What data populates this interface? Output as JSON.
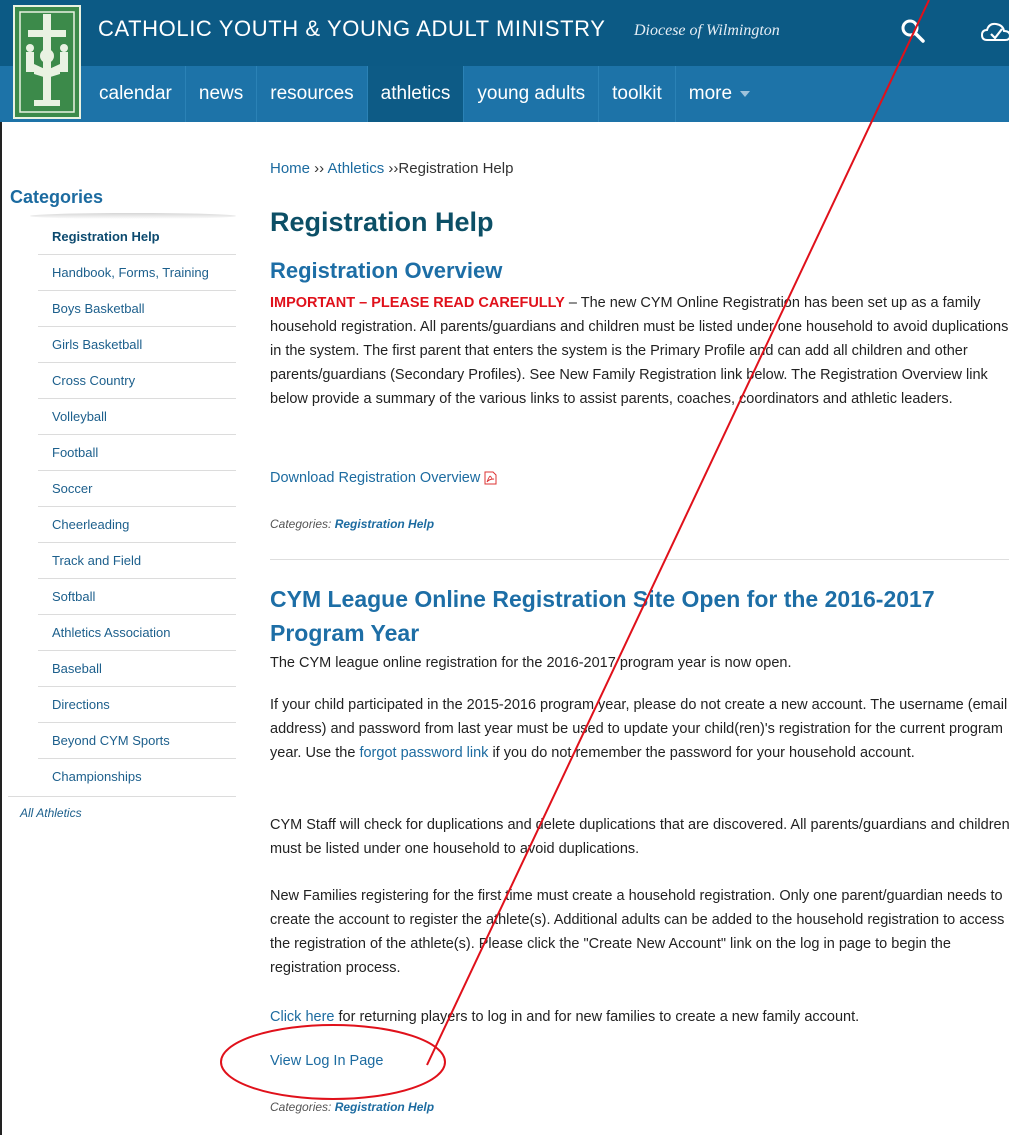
{
  "header": {
    "site_title": "CATHOLIC YOUTH & YOUNG ADULT MINISTRY",
    "diocese": "Diocese of Wilmington",
    "icons": {
      "search": "search-icon",
      "cloud": "cloud-check-icon",
      "logo": "ministry-logo-icon"
    },
    "nav": [
      {
        "label": "calendar"
      },
      {
        "label": "news"
      },
      {
        "label": "resources"
      },
      {
        "label": "athletics",
        "active": true
      },
      {
        "label": "young adults"
      },
      {
        "label": "toolkit"
      },
      {
        "label": "more"
      }
    ],
    "colors": {
      "top": "#0c5a85",
      "nav": "#1d73a8",
      "active": "#0d5b86"
    }
  },
  "breadcrumb": {
    "home": "Home",
    "sep1": " ›› ",
    "athletics": "Athletics",
    "sep2": " ››",
    "current": "Registration Help"
  },
  "sidebar": {
    "heading": "Categories",
    "items": [
      "Registration Help",
      "Handbook, Forms, Training",
      "Boys Basketball",
      "Girls Basketball",
      "Cross Country",
      "Volleyball",
      "Football",
      "Soccer",
      "Cheerleading",
      "Track and Field",
      "Softball",
      "Athletics Association",
      "Baseball",
      "Directions",
      "Beyond CYM Sports",
      "Championships"
    ],
    "all_link": "All Athletics"
  },
  "main": {
    "page_title": "Registration Help",
    "post1": {
      "title": "Registration Overview",
      "important": "IMPORTANT – PLEASE READ CAREFULLY",
      "body": " – The new CYM Online Registration has been set up as a family household registration.  All parents/guardians and children must be listed under one household to avoid duplications in the system.  The first parent that enters the system is the Primary Profile and can add all children and other parents/guardians (Secondary Profiles). See New Family Registration link below.  The Registration Overview link below provide a summary of the various links to assist parents, coaches, coordinators and athletic leaders.",
      "download_link": "Download Registration Overview",
      "categories_label": "Categories:",
      "categories_value": "Registration Help"
    },
    "post2": {
      "title_line1": "CYM League Online Registration Site Open for the 2016-2017",
      "title_line2": "Program Year",
      "intro": "The CYM league online registration for the 2016-2017 program year is now open.",
      "p2_before": "If your child participated in the 2015-2016 program year, please do not create a new account. The username (email address) and password from last year must be used to update your child(ren)'s registration for the current program year. Use the ",
      "p2_link": "forgot password link",
      "p2_after": " if you do not remember the password for your household account.",
      "p3": "CYM Staff will check for duplications and delete duplications that are discovered. All parents/guardians and children must be listed under one household to avoid duplications.",
      "p4": "New Families registering for the first time must create a household registration. Only one parent/guardian needs to create the account to register the athlete(s). Additional adults can be added to the household registration to access the registration of the athlete(s). Please click the \"Create New Account\" link on the log in page to begin the registration process.",
      "p5_link": "Click here",
      "p5_after": " for returning players to log in and for new families to create a new family account.",
      "login_link": "View Log In Page",
      "categories_label": "Categories:",
      "categories_value": "Registration Help"
    }
  },
  "annotations": {
    "color": "#e0111b"
  }
}
